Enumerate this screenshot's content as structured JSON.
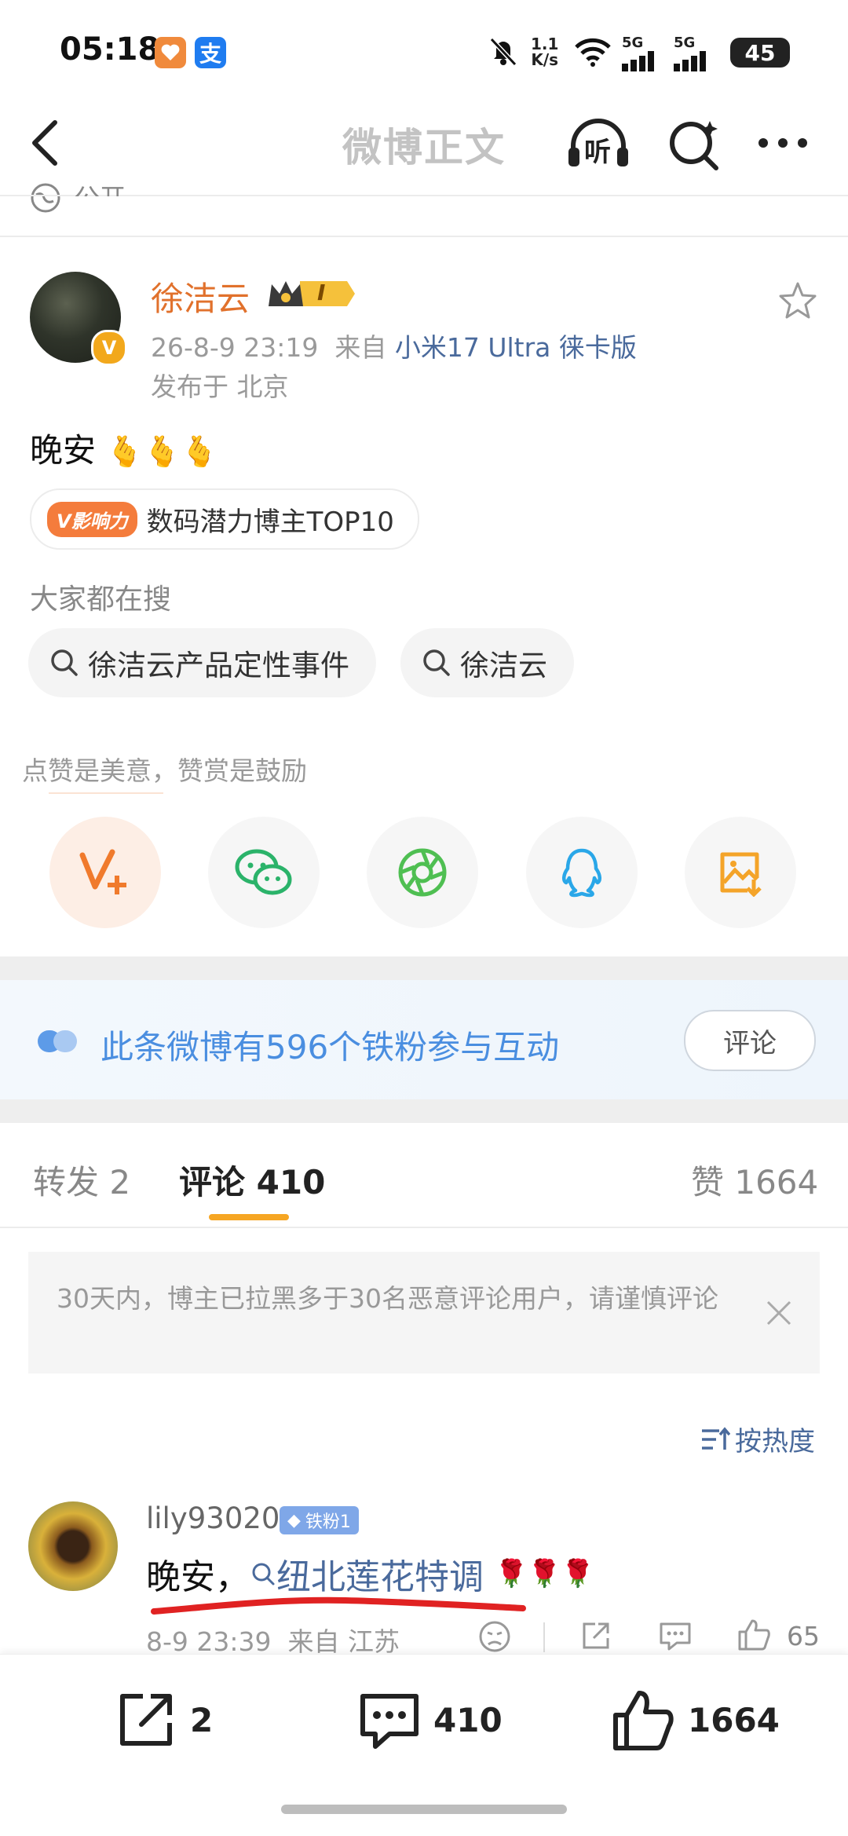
{
  "status_bar": {
    "time": "05:18",
    "network_speed_top": "1.1",
    "network_speed_unit": "K/s",
    "signal_1": "5G",
    "signal_2": "5G",
    "battery": "45",
    "alipay_char": "支"
  },
  "nav": {
    "title": "微博正文",
    "listen_label": "听"
  },
  "prev_visibility": "公开",
  "post": {
    "author": "徐洁云",
    "member_badge": "I",
    "time": "26-8-9 23:19",
    "source_prefix": "来自",
    "source": "小米17 Ultra 徕卡版",
    "location": "发布于 北京",
    "text": "晚安",
    "influence_badge": "V影响力",
    "influence_text": "数码潜力博主TOP10",
    "search_section": "大家都在搜",
    "search_tags": [
      "徐洁云产品定性事件",
      "徐洁云"
    ],
    "encourage": "点赞是美意，赞赏是鼓励"
  },
  "share_targets": [
    "reward-icon",
    "wechat-icon",
    "moments-icon",
    "qq-icon",
    "save-image-icon"
  ],
  "fan_banner": {
    "text": "此条微博有596个铁粉参与互动",
    "button": "评论"
  },
  "tabs": {
    "repost": "转发 2",
    "comment": "评论 410",
    "like": "赞 1664"
  },
  "notice": "30天内，博主已拉黑多于30名恶意评论用户，请谨慎评论",
  "sort_label": "按热度",
  "comment": {
    "user": "lily93020",
    "badge": "铁粉1",
    "text_prefix": "晚安，",
    "link": "纽北莲花特调",
    "time": "8-9 23:39",
    "source": "来自 江苏",
    "likes": "65"
  },
  "bottom_bar": {
    "repost": "2",
    "comment": "410",
    "like": "1664"
  },
  "colors": {
    "accent_orange": "#e1712c",
    "link_blue": "#4a6a9c",
    "tab_underline": "#f6a623",
    "banner_blue": "#4a8ee0"
  }
}
